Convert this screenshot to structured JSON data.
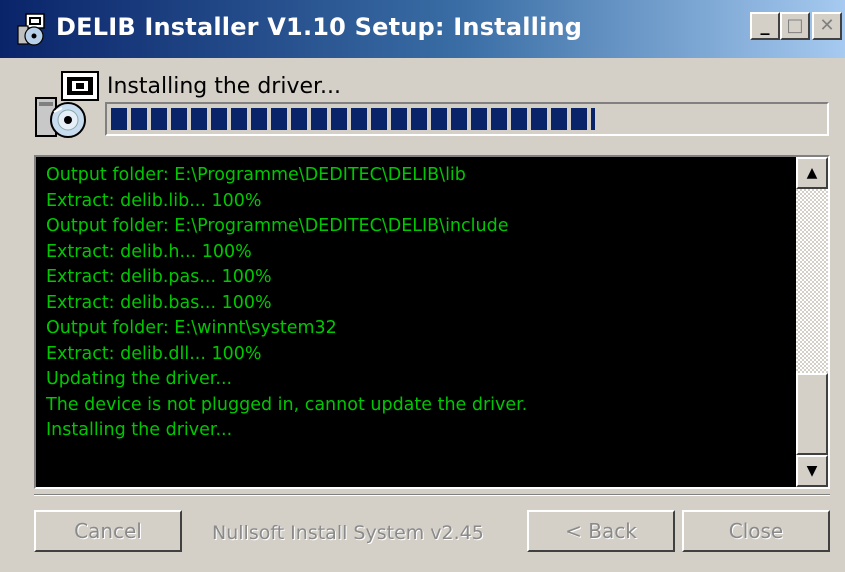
{
  "window": {
    "title": "DELIB Installer V1.10 Setup: Installing",
    "controls": {
      "minimize": "_",
      "maximize": "□",
      "close": "✕"
    }
  },
  "header": {
    "status": "Installing the driver...",
    "icon": "installer-disk-icon",
    "progress_fraction": 0.68,
    "progress_color": "#0a246a"
  },
  "log": {
    "text_color": "#00c800",
    "background": "#000000",
    "lines": [
      "Output folder: E:\\Programme\\DEDITEC\\DELIB\\lib",
      "Extract: delib.lib... 100%",
      "Output folder: E:\\Programme\\DEDITEC\\DELIB\\include",
      "Extract: delib.h... 100%",
      "Extract: delib.pas... 100%",
      "Extract: delib.bas... 100%",
      "Output folder: E:\\winnt\\system32",
      "Extract: delib.dll... 100%",
      "Updating the driver...",
      "The device is not plugged in, cannot update the driver.",
      "Installing the driver..."
    ],
    "scroll_up": "▲",
    "scroll_down": "▼"
  },
  "footer": {
    "cancel_label": "Cancel",
    "branding": "Nullsoft Install System v2.45",
    "back_label": "< Back",
    "close_label": "Close"
  }
}
